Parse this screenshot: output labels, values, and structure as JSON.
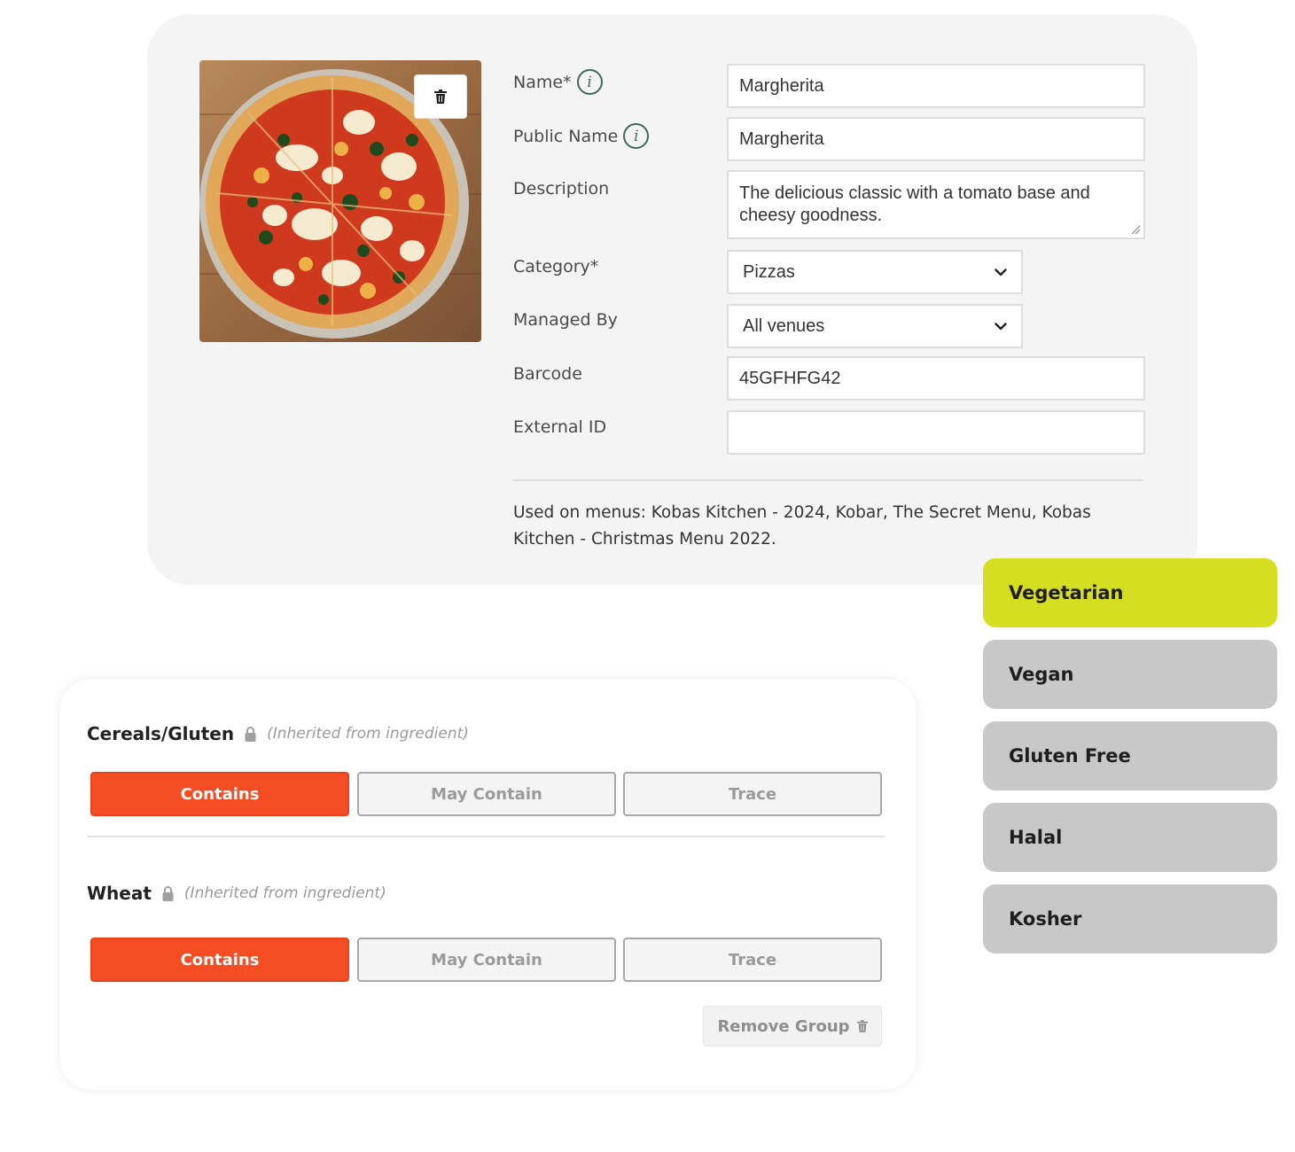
{
  "item": {
    "photo_alt": "Margherita pizza photo",
    "fields": {
      "name": {
        "label": "Name*",
        "value": "Margherita"
      },
      "public_name": {
        "label": "Public Name",
        "value": "Margherita"
      },
      "description": {
        "label": "Description",
        "value": "The delicious classic with a tomato base and cheesy goodness."
      },
      "category": {
        "label": "Category*",
        "value": "Pizzas"
      },
      "managed_by": {
        "label": "Managed By",
        "value": "All venues"
      },
      "barcode": {
        "label": "Barcode",
        "value": "45GFHFG42"
      },
      "external_id": {
        "label": "External ID",
        "value": ""
      }
    },
    "info_glyph": "i",
    "used_on_menus": "Used on menus: Kobas Kitchen - 2024, Kobar, The Secret Menu, Kobas Kitchen - Christmas Menu 2022."
  },
  "dietary": {
    "tags": [
      {
        "label": "Vegetarian",
        "active": true
      },
      {
        "label": "Vegan",
        "active": false
      },
      {
        "label": "Gluten Free",
        "active": false
      },
      {
        "label": "Halal",
        "active": false
      },
      {
        "label": "Kosher",
        "active": false
      }
    ],
    "active_color": "#d6de21",
    "inactive_color": "#c8c8c8"
  },
  "allergens": {
    "groups": [
      {
        "name": "Cereals/Gluten",
        "note": "(Inherited from ingredient)",
        "options": [
          "Contains",
          "May Contain",
          "Trace"
        ],
        "selected": "Contains"
      },
      {
        "name": "Wheat",
        "note": "(Inherited from ingredient)",
        "options": [
          "Contains",
          "May Contain",
          "Trace"
        ],
        "selected": "Contains"
      }
    ],
    "remove_group_label": "Remove Group",
    "selected_color": "#f44d24"
  },
  "icons": {
    "info": "info-icon",
    "trash": "trash-icon",
    "lock": "lock-icon",
    "chevron": "chevron-down-icon"
  }
}
